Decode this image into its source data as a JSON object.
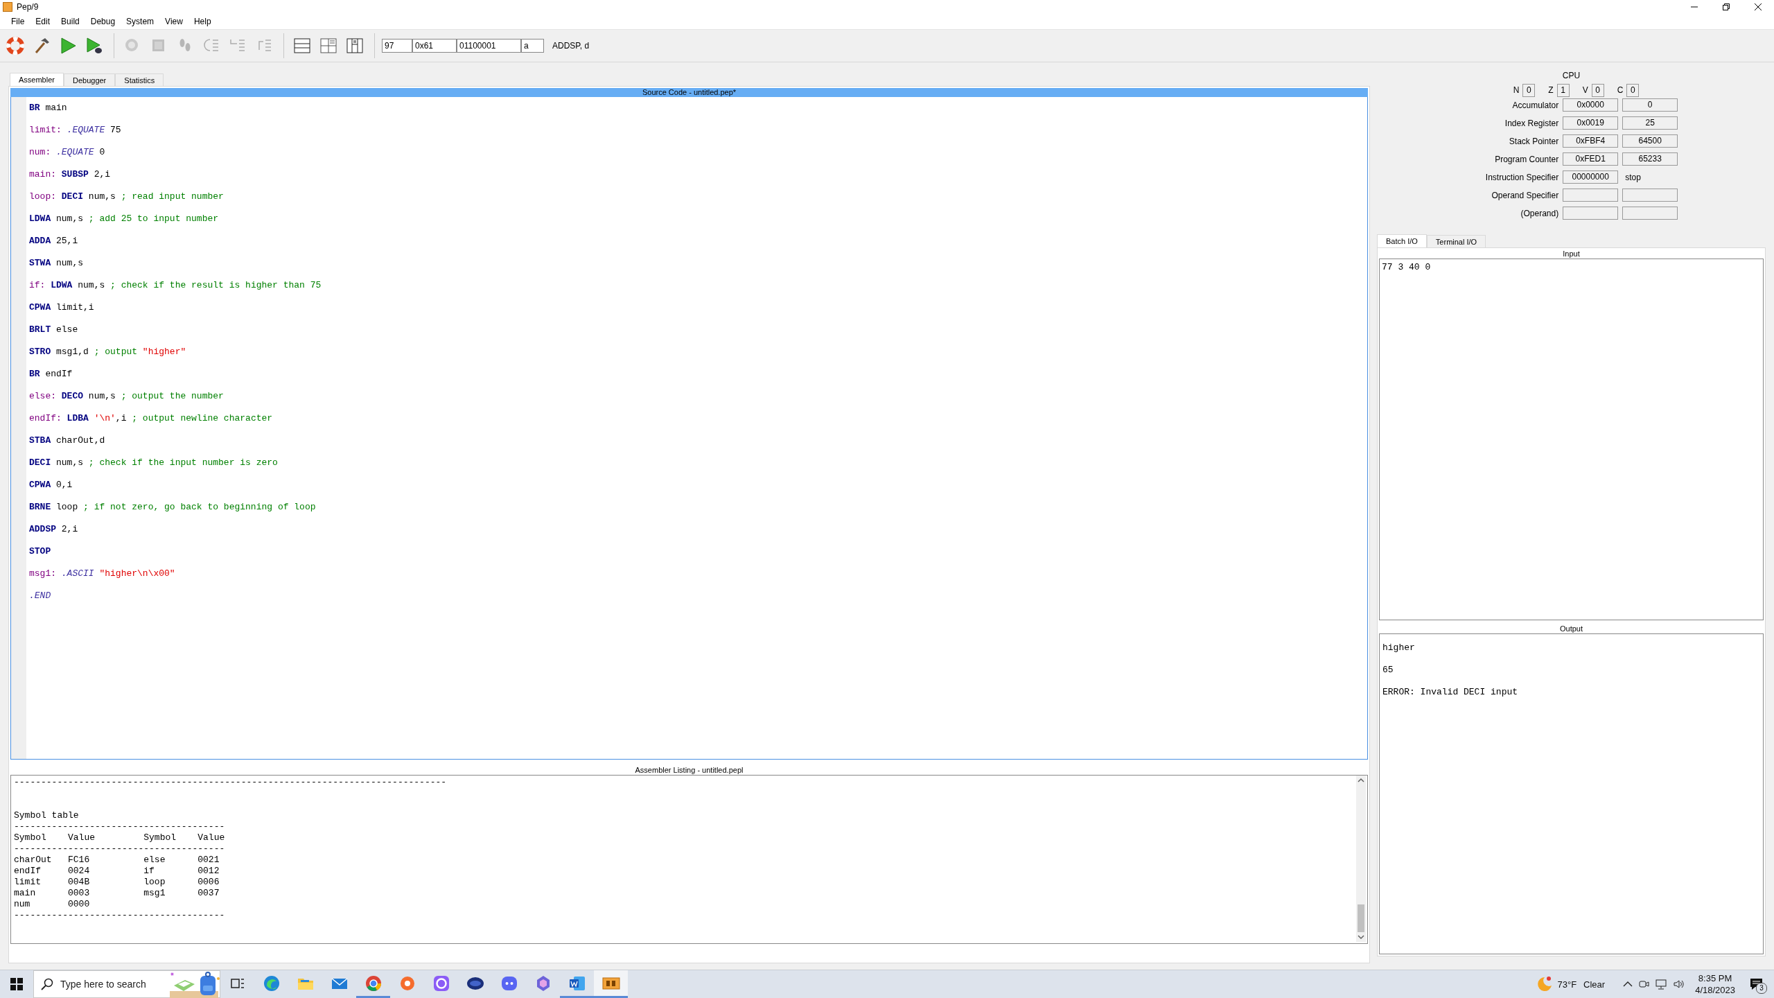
{
  "window": {
    "title": "Pep/9"
  },
  "menu": [
    "File",
    "Edit",
    "Build",
    "Debug",
    "System",
    "View",
    "Help"
  ],
  "toolbar": {
    "buttons": [
      {
        "kind": "lifebuoy",
        "disabled": false
      },
      {
        "kind": "hammer",
        "disabled": false
      },
      {
        "kind": "run",
        "disabled": false
      },
      {
        "kind": "debug",
        "disabled": false
      },
      {
        "kind": "start-debug",
        "disabled": true
      },
      {
        "kind": "stop",
        "disabled": true
      },
      {
        "kind": "footsteps",
        "disabled": true
      },
      {
        "kind": "step-over",
        "disabled": true
      },
      {
        "kind": "step-into",
        "disabled": true
      },
      {
        "kind": "step-out",
        "disabled": true
      },
      {
        "kind": "layout-rows",
        "disabled": false
      },
      {
        "kind": "layout-split",
        "disabled": false
      },
      {
        "kind": "layout-grid",
        "disabled": false
      }
    ],
    "fields": [
      "97",
      "0x61",
      "01100001",
      "a"
    ],
    "instruction": "ADDSP, d"
  },
  "tabs": [
    {
      "label": "Assembler",
      "selected": true
    },
    {
      "label": "Debugger",
      "selected": false
    },
    {
      "label": "Statistics",
      "selected": false
    }
  ],
  "source": {
    "title": "Source Code - untitled.pep*",
    "lines": [
      {
        "parts": [
          {
            "kind": "op",
            "text": "BR"
          },
          {
            "kind": "plain",
            "text": " main"
          }
        ]
      },
      {
        "parts": [
          {
            "kind": "label",
            "text": "limit: "
          },
          {
            "kind": "dir",
            "text": ".EQUATE"
          },
          {
            "kind": "plain",
            "text": " 75"
          }
        ]
      },
      {
        "parts": [
          {
            "kind": "label",
            "text": "num: "
          },
          {
            "kind": "dir",
            "text": ".EQUATE"
          },
          {
            "kind": "plain",
            "text": " 0"
          }
        ]
      },
      {
        "parts": [
          {
            "kind": "label",
            "text": "main: "
          },
          {
            "kind": "op",
            "text": "SUBSP"
          },
          {
            "kind": "plain",
            "text": " 2,i"
          }
        ]
      },
      {
        "parts": [
          {
            "kind": "label",
            "text": "loop: "
          },
          {
            "kind": "op",
            "text": "DECI"
          },
          {
            "kind": "plain",
            "text": " num,s "
          },
          {
            "kind": "comment",
            "text": "; read input number"
          }
        ]
      },
      {
        "parts": [
          {
            "kind": "op",
            "text": "LDWA"
          },
          {
            "kind": "plain",
            "text": " num,s "
          },
          {
            "kind": "comment",
            "text": "; add 25 to input number"
          }
        ]
      },
      {
        "parts": [
          {
            "kind": "op",
            "text": "ADDA"
          },
          {
            "kind": "plain",
            "text": " 25,i"
          }
        ]
      },
      {
        "parts": [
          {
            "kind": "op",
            "text": "STWA"
          },
          {
            "kind": "plain",
            "text": " num,s"
          }
        ]
      },
      {
        "parts": [
          {
            "kind": "label",
            "text": "if: "
          },
          {
            "kind": "op",
            "text": "LDWA"
          },
          {
            "kind": "plain",
            "text": " num,s "
          },
          {
            "kind": "comment",
            "text": "; check if the result is higher than 75"
          }
        ]
      },
      {
        "parts": [
          {
            "kind": "op",
            "text": "CPWA"
          },
          {
            "kind": "plain",
            "text": " limit,i"
          }
        ]
      },
      {
        "parts": [
          {
            "kind": "op",
            "text": "BRLT"
          },
          {
            "kind": "plain",
            "text": " else"
          }
        ]
      },
      {
        "parts": [
          {
            "kind": "op",
            "text": "STRO"
          },
          {
            "kind": "plain",
            "text": " msg1,d "
          },
          {
            "kind": "comment",
            "text": "; output "
          },
          {
            "kind": "string",
            "text": "\"higher\""
          }
        ]
      },
      {
        "parts": [
          {
            "kind": "op",
            "text": "BR"
          },
          {
            "kind": "plain",
            "text": " endIf"
          }
        ]
      },
      {
        "parts": [
          {
            "kind": "label",
            "text": "else: "
          },
          {
            "kind": "op",
            "text": "DECO"
          },
          {
            "kind": "plain",
            "text": " num,s "
          },
          {
            "kind": "comment",
            "text": "; output the number"
          }
        ]
      },
      {
        "parts": [
          {
            "kind": "label",
            "text": "endIf: "
          },
          {
            "kind": "op",
            "text": "LDBA"
          },
          {
            "kind": "string",
            "text": " '\\n'"
          },
          {
            "kind": "plain",
            "text": ",i "
          },
          {
            "kind": "comment",
            "text": "; output newline character"
          }
        ]
      },
      {
        "parts": [
          {
            "kind": "op",
            "text": "STBA"
          },
          {
            "kind": "plain",
            "text": " charOut,d"
          }
        ]
      },
      {
        "parts": [
          {
            "kind": "op",
            "text": "DECI"
          },
          {
            "kind": "plain",
            "text": " num,s "
          },
          {
            "kind": "comment",
            "text": "; check if the input number is zero"
          }
        ]
      },
      {
        "parts": [
          {
            "kind": "op",
            "text": "CPWA"
          },
          {
            "kind": "plain",
            "text": " 0,i"
          }
        ]
      },
      {
        "parts": [
          {
            "kind": "op",
            "text": "BRNE"
          },
          {
            "kind": "plain",
            "text": " loop "
          },
          {
            "kind": "comment",
            "text": "; if not zero, go back to beginning of loop"
          }
        ]
      },
      {
        "parts": [
          {
            "kind": "op",
            "text": "ADDSP"
          },
          {
            "kind": "plain",
            "text": " 2,i"
          }
        ]
      },
      {
        "parts": [
          {
            "kind": "op",
            "text": "STOP"
          }
        ]
      },
      {
        "parts": [
          {
            "kind": "label",
            "text": "msg1: "
          },
          {
            "kind": "dir",
            "text": ".ASCII"
          },
          {
            "kind": "string",
            "text": " \"higher\\n\\x00\""
          }
        ]
      },
      {
        "parts": [
          {
            "kind": "dir",
            "text": ".END"
          }
        ]
      }
    ]
  },
  "listing": {
    "title": "Assembler Listing - untitled.pepl",
    "lines": [
      "--------------------------------------------------------------------------------",
      "Symbol table",
      "---------------------------------------",
      "Symbol    Value         Symbol    Value",
      "---------------------------------------",
      "charOut   FC16          else      0021",
      "endIf     0024          if        0012",
      "limit     004B          loop      0006",
      "main      0003          msg1      0037",
      "num       0000",
      "---------------------------------------"
    ]
  },
  "cpu": {
    "title": "CPU",
    "flags": [
      {
        "name": "N",
        "value": "0"
      },
      {
        "name": "Z",
        "value": "1"
      },
      {
        "name": "V",
        "value": "0"
      },
      {
        "name": "C",
        "value": "0"
      }
    ],
    "registers": [
      {
        "kind": "pair",
        "label": "Accumulator",
        "hex": "0x0000",
        "dec": "0"
      },
      {
        "kind": "pair",
        "label": "Index Register",
        "hex": "0x0019",
        "dec": "25"
      },
      {
        "kind": "pair",
        "label": "Stack Pointer",
        "hex": "0xFBF4",
        "dec": "64500"
      },
      {
        "kind": "pair",
        "label": "Program Counter",
        "hex": "0xFED1",
        "dec": "65233"
      },
      {
        "kind": "mnemonic",
        "label": "Instruction Specifier",
        "hex": "00000000",
        "mnemonic": "stop"
      },
      {
        "kind": "pair",
        "label": "Operand Specifier"
      },
      {
        "kind": "pair",
        "label": "(Operand)"
      }
    ]
  },
  "io": {
    "tabs": [
      {
        "label": "Batch I/O",
        "selected": true
      },
      {
        "label": "Terminal I/O",
        "selected": false
      }
    ],
    "input": {
      "title": "Input",
      "text": "77 3 40 0"
    },
    "output": {
      "title": "Output",
      "lines": [
        "higher",
        "65",
        "ERROR: Invalid DECI input"
      ]
    }
  },
  "taskbar": {
    "search": {
      "placeholder": "Type here to search"
    },
    "apps": [
      {
        "kind": "task-view",
        "running": false,
        "selected": false
      },
      {
        "kind": "edge",
        "running": false,
        "selected": false
      },
      {
        "kind": "folder",
        "running": false,
        "selected": false
      },
      {
        "kind": "mail",
        "running": false,
        "selected": false
      },
      {
        "kind": "chrome",
        "running": true,
        "selected": false
      },
      {
        "kind": "orange",
        "running": false,
        "selected": false
      },
      {
        "kind": "ring",
        "running": false,
        "selected": false
      },
      {
        "kind": "blue",
        "running": false,
        "selected": false
      },
      {
        "kind": "discord",
        "running": false,
        "selected": false
      },
      {
        "kind": "copilot",
        "running": false,
        "selected": false
      },
      {
        "kind": "word",
        "running": true,
        "selected": false
      },
      {
        "kind": "pep9",
        "running": true,
        "selected": true
      }
    ],
    "weather": {
      "temp": "73°F",
      "condition": "Clear"
    },
    "time": "8:35 PM",
    "date": "4/18/2023",
    "notifications": "3"
  }
}
